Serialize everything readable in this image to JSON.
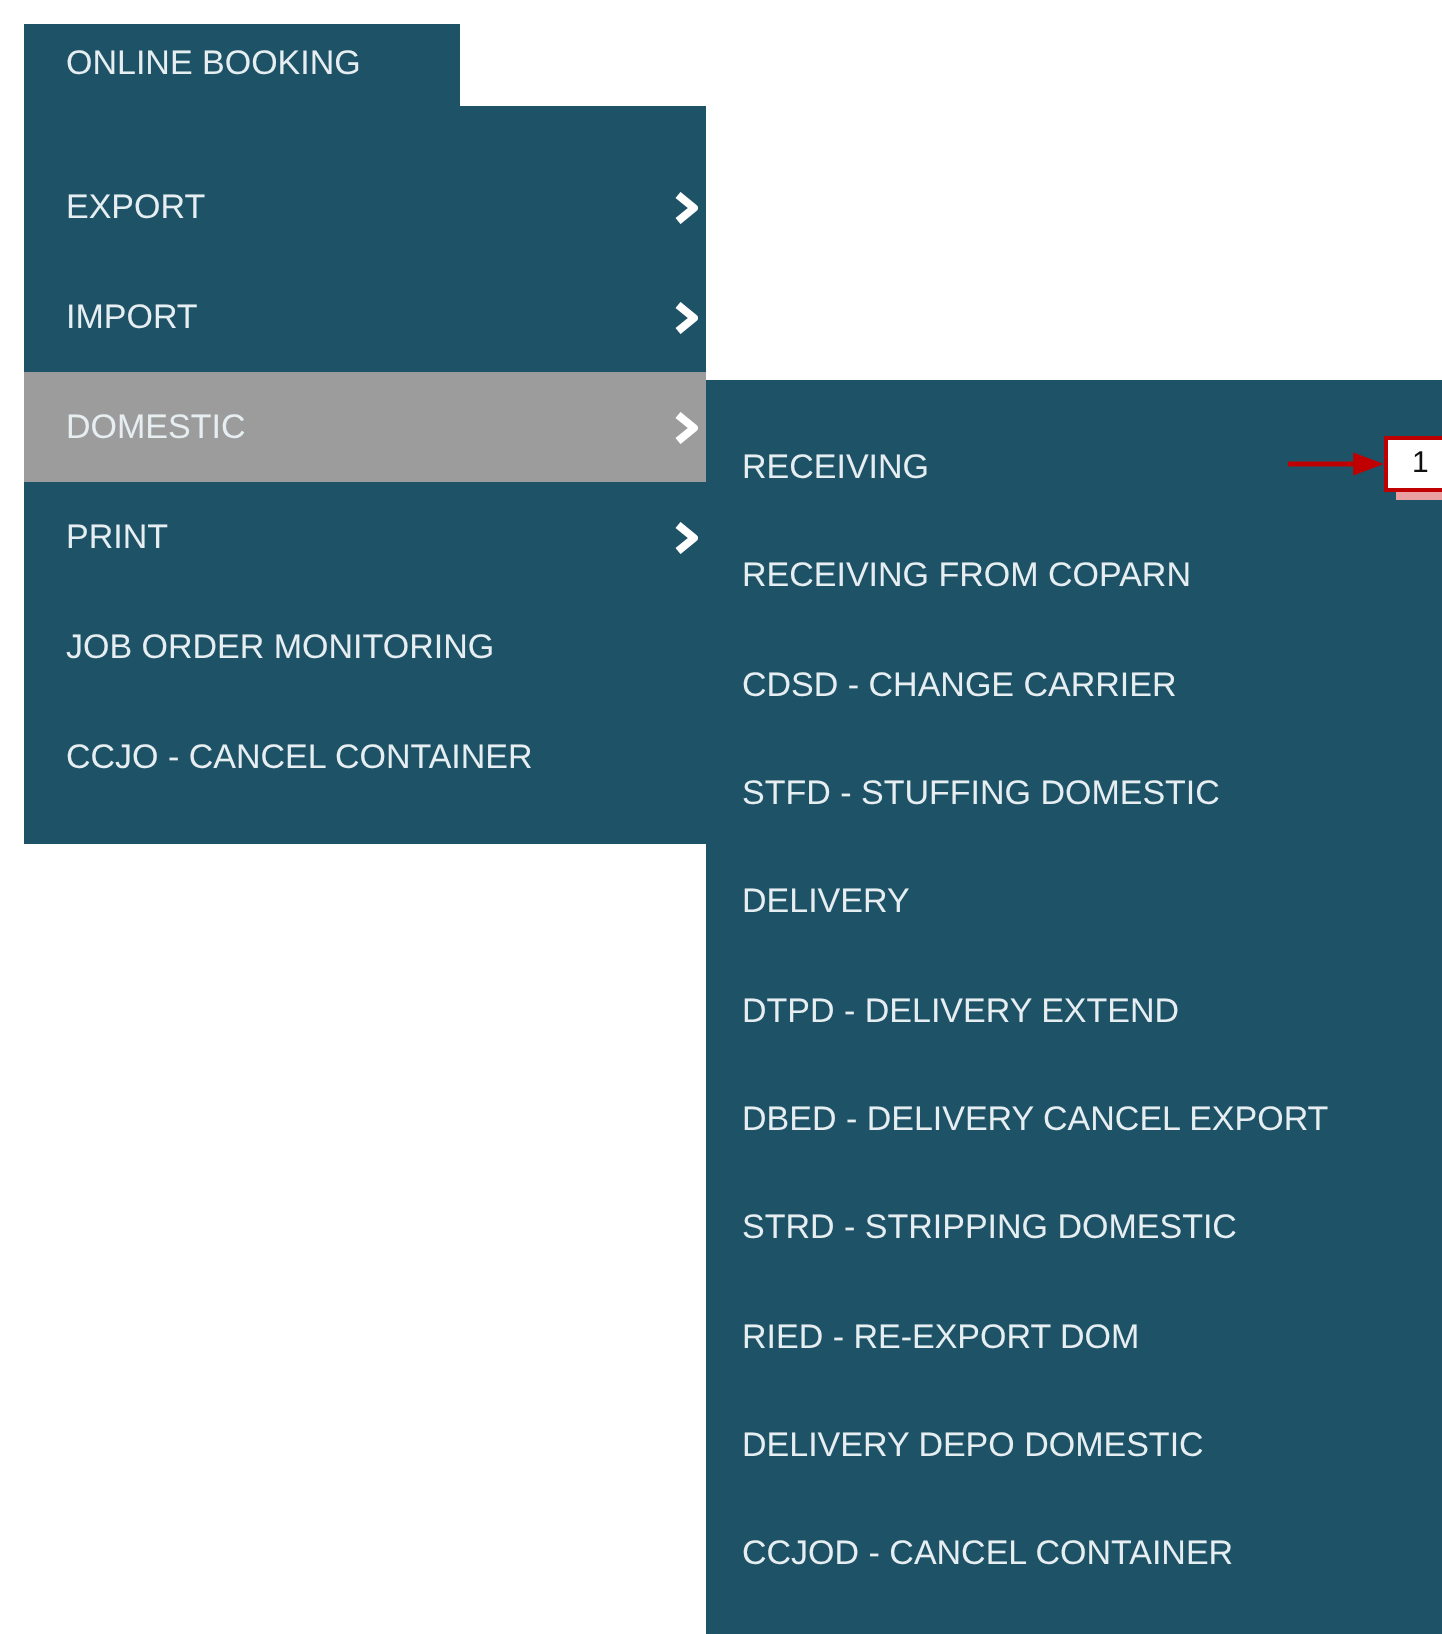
{
  "menu_tab": {
    "label": "ONLINE BOOKING"
  },
  "menu": {
    "items": [
      {
        "label": "EXPORT",
        "has_submenu": true,
        "selected": false
      },
      {
        "label": "IMPORT",
        "has_submenu": true,
        "selected": false
      },
      {
        "label": "DOMESTIC",
        "has_submenu": true,
        "selected": true
      },
      {
        "label": "PRINT",
        "has_submenu": true,
        "selected": false
      },
      {
        "label": "JOB ORDER MONITORING",
        "has_submenu": false,
        "selected": false
      },
      {
        "label": "CCJO - CANCEL CONTAINER",
        "has_submenu": false,
        "selected": false
      }
    ]
  },
  "submenu": {
    "items": [
      {
        "label": "RECEIVING"
      },
      {
        "label": "RECEIVING FROM COPARN"
      },
      {
        "label": "CDSD - CHANGE CARRIER"
      },
      {
        "label": "STFD - STUFFING DOMESTIC"
      },
      {
        "label": "DELIVERY"
      },
      {
        "label": "DTPD - DELIVERY EXTEND"
      },
      {
        "label": "DBED - DELIVERY CANCEL EXPORT"
      },
      {
        "label": "STRD - STRIPPING DOMESTIC"
      },
      {
        "label": "RIED - RE-EXPORT DOM"
      },
      {
        "label": "DELIVERY DEPO DOMESTIC"
      },
      {
        "label": "CCJOD - CANCEL CONTAINER"
      }
    ]
  },
  "annotation": {
    "label": "1"
  }
}
